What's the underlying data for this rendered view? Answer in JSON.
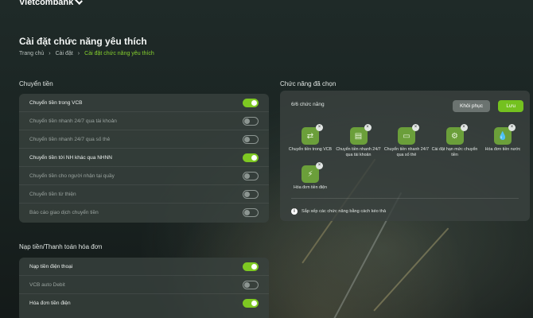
{
  "brand": {
    "name": "Vietcombank"
  },
  "page": {
    "title": "Cài đặt chức năng yêu thích"
  },
  "breadcrumb": [
    "Trang chủ",
    "Cài đặt",
    "Cài đặt chức năng yêu thích"
  ],
  "breadcrumb_separator": "›",
  "transfer": {
    "title": "Chuyển tiền",
    "items": [
      {
        "label": "Chuyển tiền trong VCB",
        "enabled": true
      },
      {
        "label": "Chuyển tiền nhanh 24/7 qua tài khoản",
        "enabled": false
      },
      {
        "label": "Chuyển tiền nhanh 24/7 qua số thẻ",
        "enabled": false
      },
      {
        "label": "Chuyển tiền tới NH khác qua NHNN",
        "enabled": true
      },
      {
        "label": "Chuyển tiền cho người nhận tại quầy",
        "enabled": false
      },
      {
        "label": "Chuyển tiền từ thiện",
        "enabled": false
      },
      {
        "label": "Báo cáo giao dịch chuyển tiền",
        "enabled": false
      }
    ]
  },
  "topup": {
    "title": "Nạp tiền/Thanh toán hóa đơn",
    "items": [
      {
        "label": "Nạp tiền điện thoại",
        "enabled": true
      },
      {
        "label": "VCB auto Debit",
        "enabled": false
      },
      {
        "label": "Hóa đơn tiền điện",
        "enabled": true
      }
    ]
  },
  "selected": {
    "title": "Chức năng đã chọn",
    "count": "6/6 chức năng",
    "restore_label": "Khôi phục",
    "save_label": "Lưu",
    "items": [
      {
        "label": "Chuyển tiền trong VCB",
        "icon": "transfer-arrows-icon"
      },
      {
        "label": "Chuyển tiền nhanh 24/7 qua tài khoản",
        "icon": "fast-transfer-account-icon"
      },
      {
        "label": "Chuyển tiền nhanh 24/7 qua số thẻ",
        "icon": "fast-transfer-card-icon"
      },
      {
        "label": "Cài đặt hạn mức chuyển tiền",
        "icon": "limit-settings-icon"
      },
      {
        "label": "Hóa đơn tiền nước",
        "icon": "water-drop-icon"
      },
      {
        "label": "Hóa đơn tiền điện",
        "icon": "lightning-icon"
      }
    ],
    "hint": "Sắp xếp các chức năng bằng cách kéo thả"
  },
  "colors": {
    "accent": "#7ec822",
    "tile": "#6b9f3a",
    "breadcrumb_active": "#86d12e"
  }
}
